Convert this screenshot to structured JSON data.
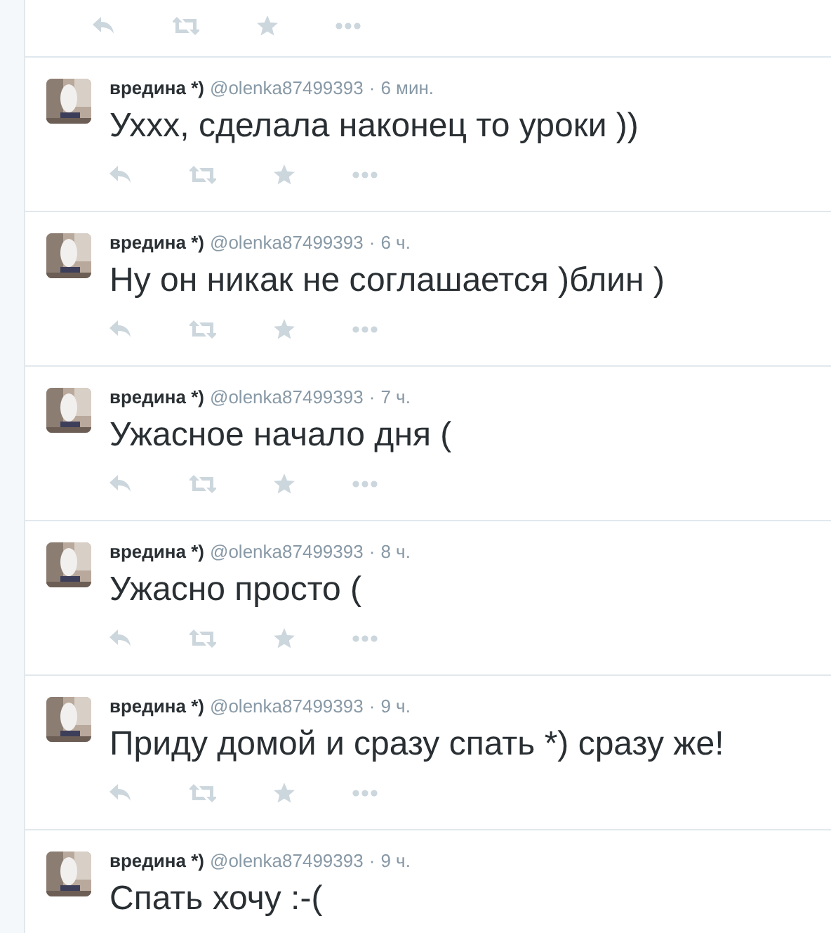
{
  "top_actions": {
    "kind": "actions"
  },
  "tweets": [
    {
      "name": "вредина *)",
      "handle": "@olenka87499393",
      "separator": "·",
      "time": "6 мин.",
      "text": "Уххх, сделала наконец то уроки ))"
    },
    {
      "name": "вредина *)",
      "handle": "@olenka87499393",
      "separator": "·",
      "time": "6 ч.",
      "text": "Ну он никак не соглашается )блин )"
    },
    {
      "name": "вредина *)",
      "handle": "@olenka87499393",
      "separator": "·",
      "time": "7 ч.",
      "text": "Ужасное начало дня ("
    },
    {
      "name": "вредина *)",
      "handle": "@olenka87499393",
      "separator": "·",
      "time": "8 ч.",
      "text": "Ужасно просто ("
    },
    {
      "name": "вредина *)",
      "handle": "@olenka87499393",
      "separator": "·",
      "time": "9 ч.",
      "text": "Приду домой и сразу спать *) сразу же!"
    },
    {
      "name": "вредина *)",
      "handle": "@olenka87499393",
      "separator": "·",
      "time": "9 ч.",
      "text": "Спать хочу :-("
    }
  ]
}
